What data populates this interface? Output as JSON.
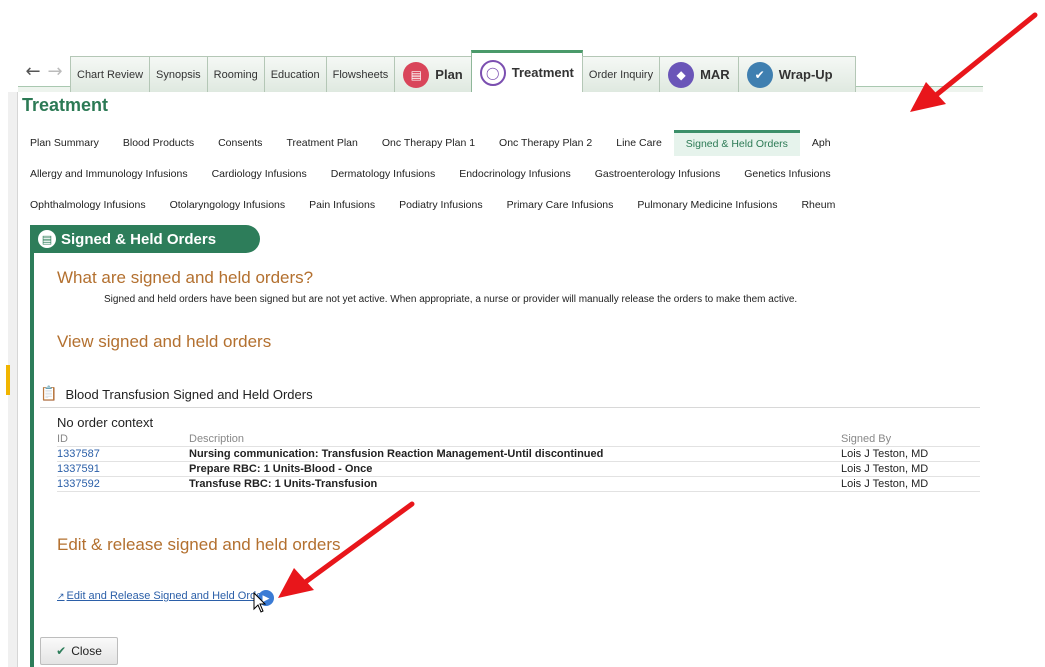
{
  "tabs": [
    {
      "label": "Chart Review",
      "type": "small"
    },
    {
      "label": "Synopsis",
      "type": "small"
    },
    {
      "label": "Rooming",
      "type": "small"
    },
    {
      "label": "Education",
      "type": "small"
    },
    {
      "label": "Flowsheets",
      "type": "small"
    },
    {
      "label": "Plan",
      "type": "big",
      "icon": "plan-icon"
    },
    {
      "label": "Treatment",
      "type": "big",
      "icon": "treatment-icon",
      "active": true
    },
    {
      "label": "Order Inquiry",
      "type": "small"
    },
    {
      "label": "MAR",
      "type": "big",
      "icon": "mar-icon"
    },
    {
      "label": "Wrap-Up",
      "type": "big",
      "icon": "wrap-up-icon"
    }
  ],
  "page_title": "Treatment",
  "subnav": {
    "row1": [
      "Plan Summary",
      "Blood Products",
      "Consents",
      "Treatment Plan",
      "Onc Therapy Plan 1",
      "Onc Therapy Plan 2",
      "Line Care",
      "Signed & Held Orders",
      "Aph"
    ],
    "row2": [
      "Allergy and Immunology Infusions",
      "Cardiology Infusions",
      "Dermatology Infusions",
      "Endocrinology Infusions",
      "Gastroenterology Infusions",
      "Genetics Infusions"
    ],
    "row3": [
      "Ophthalmology Infusions",
      "Otolaryngology Infusions",
      "Pain Infusions",
      "Podiatry Infusions",
      "Primary Care Infusions",
      "Pulmonary Medicine Infusions",
      "Rheum"
    ],
    "active": "Signed & Held Orders"
  },
  "section": {
    "title": "Signed & Held Orders",
    "what_heading": "What are signed and held orders?",
    "what_text": "Signed and held orders have been signed but are not yet active. When appropriate, a nurse or provider will manually release the orders to make them active.",
    "view_heading": "View signed and held orders",
    "report_title": "Blood Transfusion Signed and Held Orders",
    "context": "No order context",
    "table": {
      "headers": {
        "id": "ID",
        "description": "Description",
        "signed_by": "Signed By"
      },
      "rows": [
        {
          "id": "1337587",
          "description": "Nursing communication: Transfusion Reaction Management-Until discontinued",
          "signed_by": "Lois J Teston, MD"
        },
        {
          "id": "1337591",
          "description": "Prepare RBC: 1 Units-Blood - Once",
          "signed_by": "Lois J Teston, MD"
        },
        {
          "id": "1337592",
          "description": "Transfuse RBC: 1 Units-Transfusion",
          "signed_by": "Lois J Teston, MD"
        }
      ]
    },
    "edit_heading": "Edit & release signed and held orders",
    "edit_link": "Edit and Release Signed and Held Orders"
  },
  "close_label": "Close",
  "colors": {
    "accent": "#2d7d5a",
    "heading": "#b3702f",
    "link": "#2b5fa8",
    "annotation": "#e8161b"
  }
}
